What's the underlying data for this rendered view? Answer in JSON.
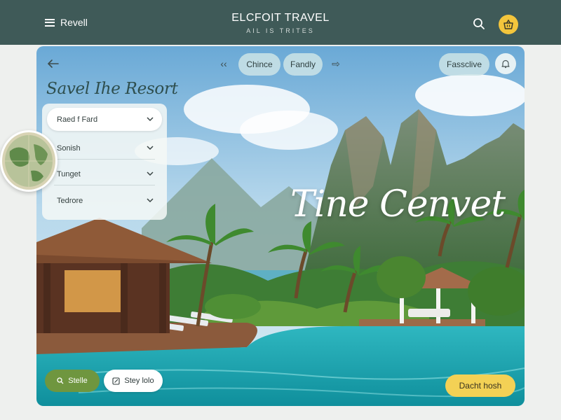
{
  "header": {
    "menu_label": "Revell",
    "brand_title": "ELCFOIT TRAVEL",
    "brand_subtitle": "AIL IS TRITES"
  },
  "hero": {
    "heading": "Savel Ihe Resort",
    "script_title": "Tine Cenvet",
    "chips": [
      "Chince",
      "Fandly",
      "Fassclive"
    ],
    "filters": [
      {
        "label": "Raed f Fard",
        "selected": true
      },
      {
        "label": "Sonish",
        "selected": false
      },
      {
        "label": "Tunget",
        "selected": false
      },
      {
        "label": "Tedrore",
        "selected": false
      }
    ],
    "buttons": {
      "explore": "Stelle",
      "stay": "Stey lolo",
      "book": "Dacht hosh"
    }
  },
  "icons": {
    "menu": "hamburger-icon",
    "search": "search-icon",
    "cart": "basket-icon",
    "back": "arrow-left-icon",
    "prev": "chevron-left-icon",
    "next": "arrow-right-icon",
    "bell": "bell-icon",
    "explore": "search-icon",
    "stay": "edit-icon",
    "globe": "globe-icon"
  },
  "colors": {
    "header_bg": "#3f5a58",
    "accent_yellow": "#f3c53c",
    "accent_green": "#6f963f"
  }
}
